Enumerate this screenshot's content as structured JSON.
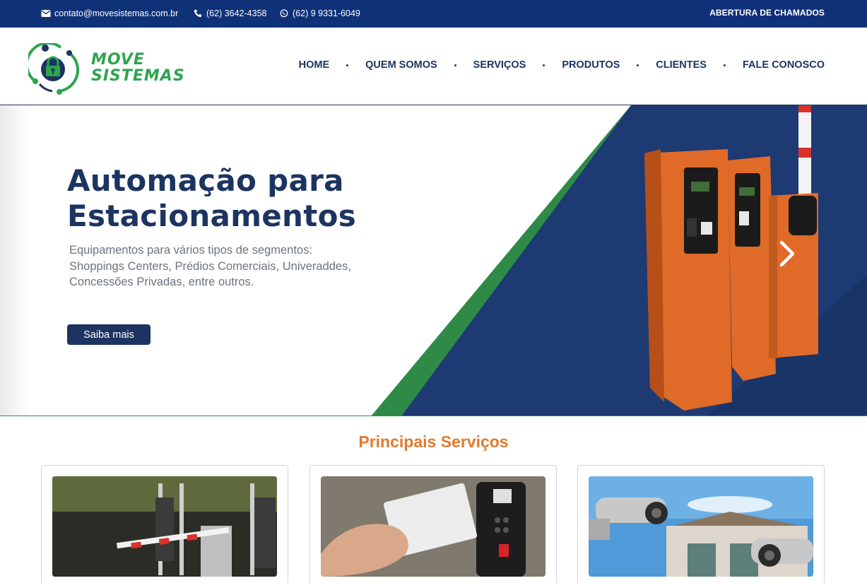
{
  "topbar": {
    "email": "contato@movesistemas.com.br",
    "phone": "(62) 3642-4358",
    "whatsapp": "(62) 9 9331-6049",
    "chamados": "ABERTURA DE CHAMADOS",
    "icons": [
      "envelope-icon",
      "phone-icon",
      "whatsapp-icon"
    ]
  },
  "logo": {
    "line1": "MOVE",
    "line2": "SISTEMAS",
    "color_green": "#2ea44f",
    "color_blue": "#1d3461"
  },
  "nav": {
    "items": [
      {
        "label": "HOME"
      },
      {
        "label": "QUEM SOMOS"
      },
      {
        "label": "SERVIÇOS"
      },
      {
        "label": "PRODUTOS"
      },
      {
        "label": "CLIENTES"
      },
      {
        "label": "FALE CONOSCO"
      }
    ]
  },
  "hero": {
    "title_line1": "Automação para",
    "title_line2": "Estacionamentos",
    "sub_line1": "Equipamentos para vários tipos de segmentos:",
    "sub_line2": "Shoppings Centers, Prédios Comerciais, Univeraddes,",
    "sub_line3": "Concessões Privadas, entre outros.",
    "button": "Saiba mais",
    "next_icon": "chevron-right-icon",
    "panel_color": "#1d3a73",
    "stripe_color": "#2f8a47",
    "machine_color": "#e06a28"
  },
  "services": {
    "title": "Principais Serviços",
    "title_color": "#e07a2d",
    "cards": [
      {
        "image": "parking-barrier-photo"
      },
      {
        "image": "access-card-photo"
      },
      {
        "image": "security-cameras-photo"
      }
    ]
  },
  "colors": {
    "topbar": "#0f3178",
    "navy": "#1d3461"
  }
}
